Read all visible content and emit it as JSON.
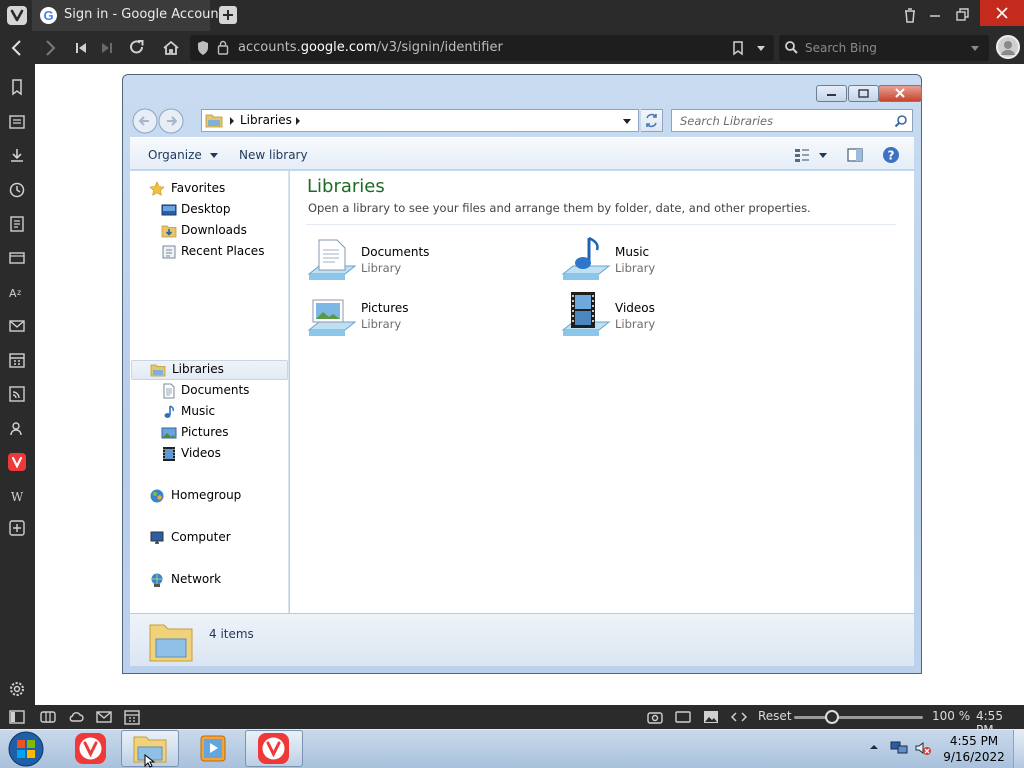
{
  "browser": {
    "tab_title": "Sign in - Google Accounts",
    "url_prefix": "accounts.",
    "url_domain": "google.com",
    "url_path": "/v3/signin/identifier",
    "search_placeholder": "Search Bing",
    "zoom_reset_label": "Reset",
    "zoom_level": "100 %",
    "zoom_fraction": 0.15,
    "status_time": "4:55 PM"
  },
  "explorer": {
    "breadcrumb": "Libraries",
    "search_placeholder": "Search Libraries",
    "commands": {
      "organize": "Organize",
      "new_library": "New library"
    },
    "nav": {
      "favorites": "Favorites",
      "favorite_items": [
        "Desktop",
        "Downloads",
        "Recent Places"
      ],
      "libraries": "Libraries",
      "library_items": [
        "Documents",
        "Music",
        "Pictures",
        "Videos"
      ],
      "homegroup": "Homegroup",
      "computer": "Computer",
      "network": "Network"
    },
    "main": {
      "title": "Libraries",
      "description": "Open a library to see your files and arrange them by folder, date, and other properties.",
      "libraries": [
        {
          "name": "Documents",
          "type": "Library",
          "icon": "documents-library-icon"
        },
        {
          "name": "Music",
          "type": "Library",
          "icon": "music-library-icon"
        },
        {
          "name": "Pictures",
          "type": "Library",
          "icon": "pictures-library-icon"
        },
        {
          "name": "Videos",
          "type": "Library",
          "icon": "videos-library-icon"
        }
      ]
    },
    "details": {
      "count": "4 items"
    }
  },
  "taskbar": {
    "time": "4:55 PM",
    "date": "9/16/2022"
  },
  "colors": {
    "vivaldi_red": "#ef3939",
    "close_red": "#c42b1c",
    "library_title_green": "#1e6b24"
  }
}
